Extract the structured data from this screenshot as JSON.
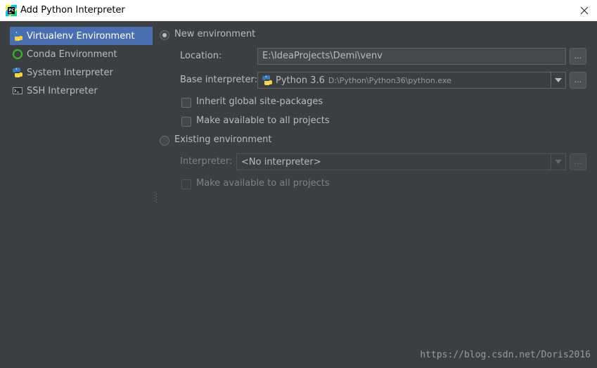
{
  "window": {
    "title": "Add Python Interpreter",
    "app_icon": "pycharm-icon",
    "close_icon": "close-icon"
  },
  "sidebar": {
    "items": [
      {
        "label": "Virtualenv Environment",
        "icon": "virtualenv-icon",
        "selected": true
      },
      {
        "label": "Conda Environment",
        "icon": "conda-icon",
        "selected": false
      },
      {
        "label": "System Interpreter",
        "icon": "python-icon",
        "selected": false
      },
      {
        "label": "SSH Interpreter",
        "icon": "ssh-icon",
        "selected": false
      }
    ]
  },
  "new_env": {
    "radio_label": "New environment",
    "selected": true,
    "location_label": "Location:",
    "location_value": "E:\\IdeaProjects\\Demi\\venv",
    "browse_label": "...",
    "base_label": "Base interpreter:",
    "base_name": "Python 3.6",
    "base_path": "D:\\Python\\Python36\\python.exe",
    "inherit_label": "Inherit global site-packages",
    "inherit_checked": false,
    "make_available_label": "Make available to all projects",
    "make_available_checked": false
  },
  "existing_env": {
    "radio_label": "Existing environment",
    "selected": false,
    "interpreter_label": "Interpreter:",
    "interpreter_value": "<No interpreter>",
    "browse_label": "...",
    "make_available_label": "Make available to all projects",
    "make_available_checked": false
  },
  "watermark": "https://blog.csdn.net/Doris2016",
  "colors": {
    "background": "#3c3f41",
    "selection": "#4b6eaf",
    "titlebar": "#ffffff"
  }
}
